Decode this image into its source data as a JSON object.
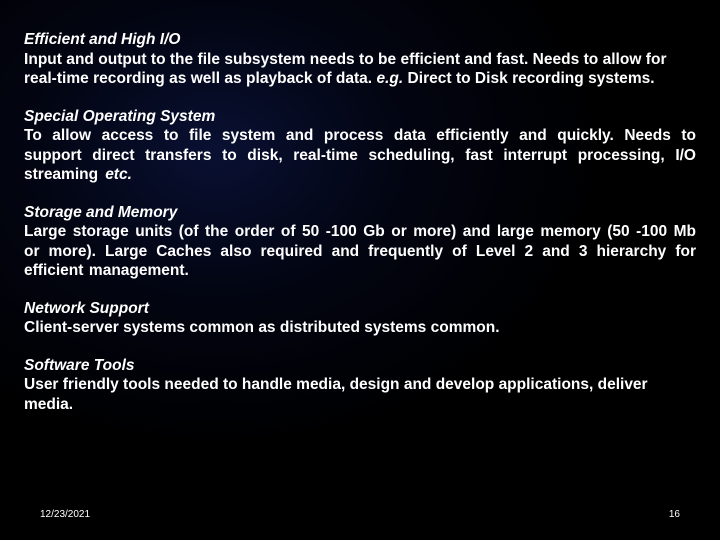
{
  "sections": [
    {
      "title": "Efficient and High I/O",
      "body_pre": "Input and output to the file subsystem needs to be efficient and fast. Needs to allow for real-time recording as well as playback of data. ",
      "body_em": "e.g.",
      "body_post": " Direct to Disk recording systems.",
      "justify": false,
      "body_class": "sec1-body"
    },
    {
      "title": "Special Operating System",
      "body_pre": "To allow access to file system and process data efficiently and quickly. Needs to support direct transfers to disk, real-time scheduling, fast interrupt processing, I/O streaming ",
      "body_em": "etc.",
      "body_post": "",
      "justify": true,
      "body_class": "sec2-body"
    },
    {
      "title": "Storage and Memory",
      "body_pre": "Large storage units (of the order of 50 -100 Gb or more) and large memory (50 -100 Mb or more). Large Caches also required and frequently of Level 2 and 3 hierarchy for efficient management.",
      "body_em": "",
      "body_post": "",
      "justify": true,
      "body_class": "sec3-body"
    },
    {
      "title": "Network Support",
      "body_pre": "Client-server systems common as distributed systems common.",
      "body_em": "",
      "body_post": "",
      "justify": false,
      "body_class": "sec4-body"
    },
    {
      "title": "Software Tools",
      "body_pre": "User friendly tools needed to handle media, design and develop applications, deliver media.",
      "body_em": "",
      "body_post": "",
      "justify": false,
      "body_class": "sec5-body"
    }
  ],
  "footer": {
    "date": "12/23/2021",
    "page": "16"
  }
}
